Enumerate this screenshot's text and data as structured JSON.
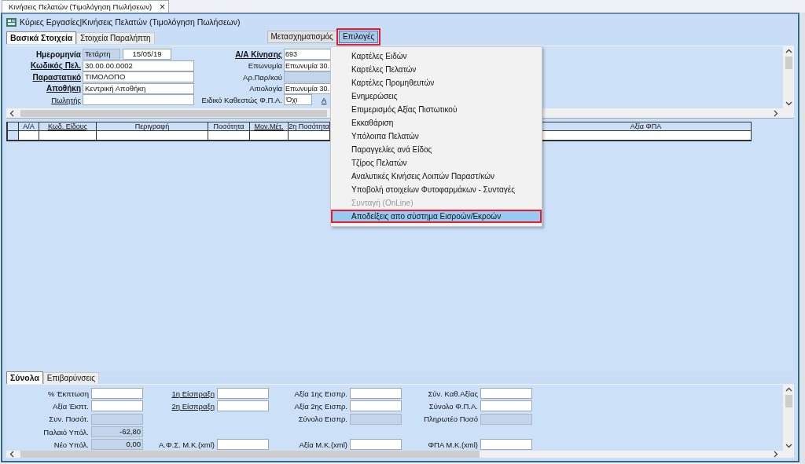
{
  "document_tab": {
    "label": "Κινήσεις Πελατών (Τιμολόγηση Πωλήσεων)",
    "close": "×"
  },
  "window": {
    "title": "Κύριες Εργασίες|Κινήσεις Πελατών (Τιμολόγηση Πωλήσεων)"
  },
  "tabs": [
    {
      "label": "Βασικά Στοιχεία",
      "selected": true
    },
    {
      "label": "Στοιχεία Παραλήπτη",
      "selected": false
    }
  ],
  "toolbar_buttons": [
    {
      "label": "Μετασχηματισμός",
      "pressed": false
    },
    {
      "label": "Επιλογές",
      "pressed": true
    }
  ],
  "header": {
    "left_fields": [
      {
        "label": "Ημερομηνία",
        "bold": true,
        "link": false,
        "inputs": [
          {
            "value": "Τετάρτη",
            "kind": "short",
            "disabled": true
          },
          {
            "value": "15/05/19",
            "kind": "date",
            "disabled": false
          }
        ]
      },
      {
        "label": "Κωδικός Πελ.",
        "bold": true,
        "link": true,
        "inputs": [
          {
            "value": "30.00.00.0002",
            "kind": "text",
            "disabled": false
          }
        ]
      },
      {
        "label": "Παραστατικό",
        "bold": true,
        "link": true,
        "inputs": [
          {
            "value": "ΤΙΜΟΛΟΠΟ",
            "kind": "text",
            "disabled": false
          }
        ]
      },
      {
        "label": "Αποθήκη",
        "bold": true,
        "link": true,
        "inputs": [
          {
            "value": "Κεντρική Αποθήκη",
            "kind": "text",
            "disabled": false
          }
        ]
      },
      {
        "label": "Πωλητής",
        "bold": false,
        "link": true,
        "inputs": [
          {
            "kind": "text",
            "disabled": false
          }
        ]
      }
    ],
    "right_fields": [
      {
        "label": "Α/Α Κίνησης",
        "bold": true,
        "link": true,
        "inputs": [
          {
            "value": "693",
            "kind": "text",
            "disabled": false
          }
        ]
      },
      {
        "label": "Επωνυμία",
        "bold": false,
        "link": false,
        "inputs": [
          {
            "value": "Επωνυμία 30.",
            "kind": "text",
            "disabled": false
          }
        ]
      },
      {
        "label": "Αρ.Παρ/κού",
        "bold": false,
        "link": false,
        "inputs": [
          {
            "kind": "text",
            "disabled": true
          }
        ]
      },
      {
        "label": "Αιτιολογία",
        "bold": false,
        "link": false,
        "inputs": [
          {
            "value": "Επωνυμία 30.",
            "kind": "text",
            "disabled": false
          }
        ]
      },
      {
        "label": "Ειδικό Καθεστώς Φ.Π.Α.",
        "bold": false,
        "link": false,
        "inputs": [
          {
            "value": "Όχι",
            "kind": "short",
            "disabled": false
          }
        ],
        "link_after": "Α"
      }
    ]
  },
  "items_grid": {
    "columns": [
      {
        "label": "Α/Α",
        "link": false
      },
      {
        "label": "Κωδ. Είδους",
        "link": true
      },
      {
        "label": "Περιγραφή",
        "link": false
      },
      {
        "label": "Ποσότητα",
        "link": false
      },
      {
        "label": "Μον.Μέτ.",
        "link": true
      },
      {
        "label": "2η Ποσότητα",
        "link": false
      },
      {
        "label": "Αξία ΦΠΑ",
        "link": false
      }
    ]
  },
  "menu": {
    "items": [
      {
        "label": "Καρτέλες Ειδών",
        "disabled": false,
        "selected": false
      },
      {
        "label": "Καρτέλες Πελατών",
        "disabled": false,
        "selected": false
      },
      {
        "label": "Καρτέλες Προμηθευτών",
        "disabled": false,
        "selected": false
      },
      {
        "label": "Ενημερώσεις",
        "disabled": false,
        "selected": false
      },
      {
        "label": "Επιμερισμός Αξίας Πιστωτικού",
        "disabled": false,
        "selected": false
      },
      {
        "label": "Εκκαθάριση",
        "disabled": false,
        "selected": false
      },
      {
        "label": "Υπόλοιπα Πελατών",
        "disabled": false,
        "selected": false
      },
      {
        "label": "Παραγγελίες ανά Είδος",
        "disabled": false,
        "selected": false
      },
      {
        "label": "Τζίρος Πελατών",
        "disabled": false,
        "selected": false
      },
      {
        "label": "Αναλυτικές Κινήσεις Λοιπών Παραστ/κών",
        "disabled": false,
        "selected": false
      },
      {
        "label": "Υποβολή στοιχείων Φυτοφαρμάκων - Συνταγές",
        "disabled": false,
        "selected": false
      },
      {
        "label": "Συνταγή (OnLine)",
        "disabled": true,
        "selected": false
      },
      {
        "label": "Αποδείξεις απο σύστημα Εισροών/Εκροών",
        "disabled": false,
        "selected": true
      }
    ]
  },
  "bottom_tabs": [
    {
      "label": "Σύνολα",
      "selected": true
    },
    {
      "label": "Επιβαρύνσεις",
      "selected": false
    }
  ],
  "totals": {
    "rows": [
      [
        {
          "label": "% Έκπτωση",
          "link": false,
          "disabled": false
        },
        {
          "label": "1η Είσπραξη",
          "link": true,
          "disabled": false
        },
        {
          "label": "Αξία 1ης Εισπρ.",
          "link": false,
          "disabled": false
        },
        {
          "label": "Σύν. Καθ.Αξίας",
          "link": false,
          "disabled": false
        }
      ],
      [
        {
          "label": "Αξία Έκπτ.",
          "link": false,
          "disabled": false
        },
        {
          "label": "2η Είσπραξη",
          "link": true,
          "disabled": false
        },
        {
          "label": "Αξία 2ης Εισπρ.",
          "link": false,
          "disabled": false
        },
        {
          "label": "Σύνολο Φ.Π.Α.",
          "link": false,
          "disabled": false
        }
      ],
      [
        {
          "label": "Συν. Ποσότ.",
          "link": false,
          "disabled": true
        },
        null,
        {
          "label": "Σύνολο Εισπρ.",
          "link": false,
          "disabled": true
        },
        {
          "label": "Πληρωτέο Ποσό",
          "link": false,
          "disabled": true
        }
      ],
      [
        {
          "label": "Παλαιό Υπόλ.",
          "link": false,
          "disabled": true,
          "value": "-62,80"
        },
        null,
        null,
        null
      ],
      [
        {
          "label": "Νέο Υπόλ.",
          "link": false,
          "disabled": true,
          "value": "0,00"
        },
        {
          "label": "Α.Φ.Σ. Μ.Κ.(xml)",
          "link": false,
          "disabled": false
        },
        {
          "label": "Αξία Μ.Κ.(xml)",
          "link": false,
          "disabled": false
        },
        {
          "label": "ΦΠΑ Μ.Κ.(xml)",
          "link": false,
          "disabled": false
        }
      ]
    ]
  }
}
